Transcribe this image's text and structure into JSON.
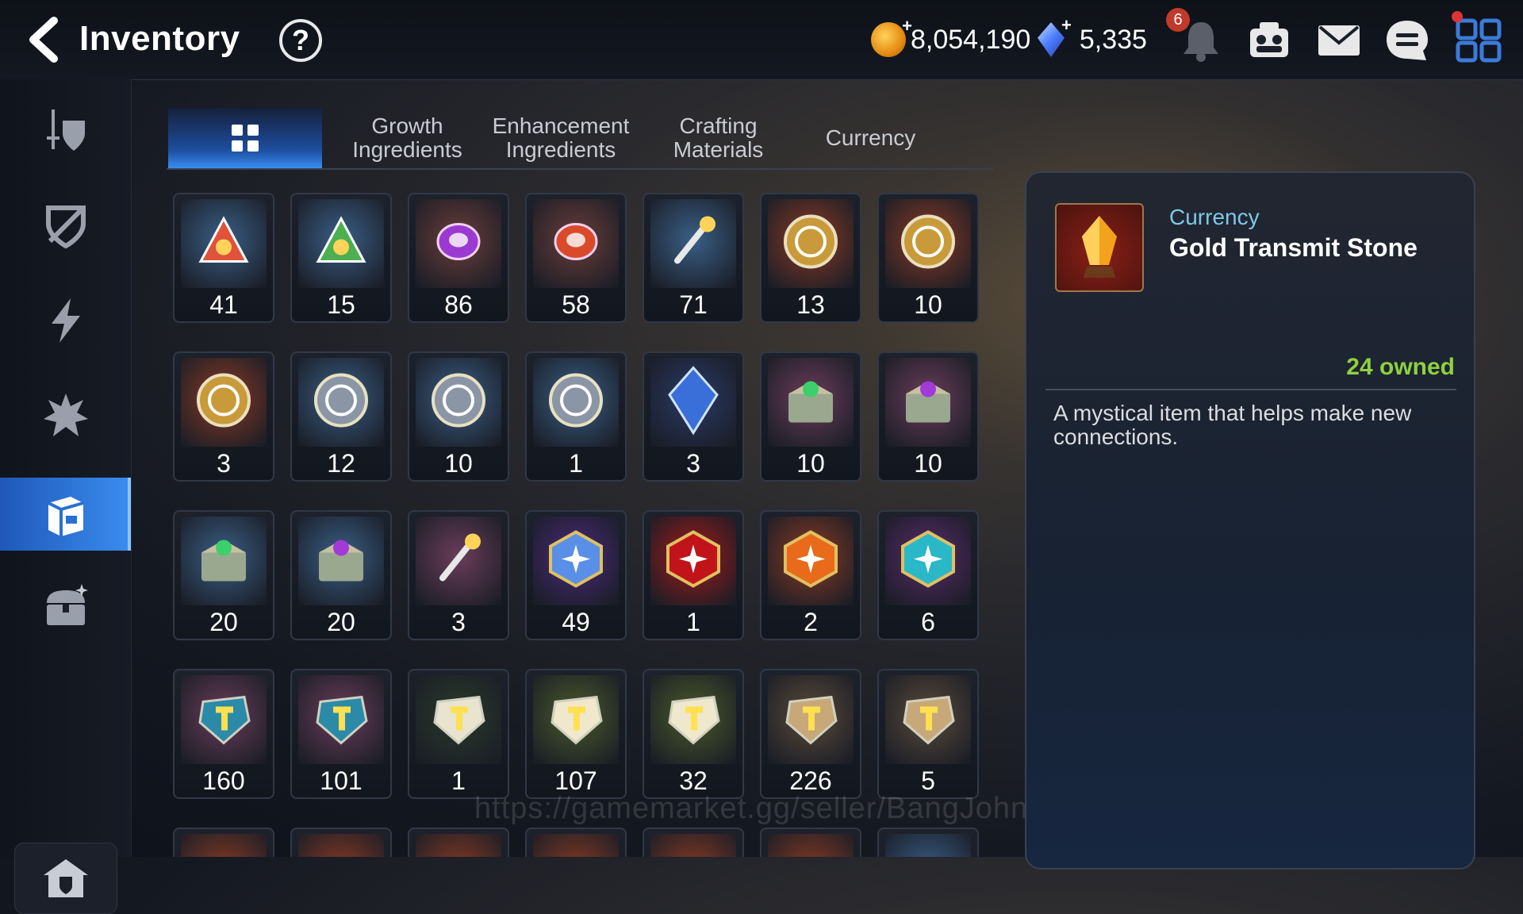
{
  "header": {
    "title": "Inventory",
    "help_label": "?",
    "gold": "8,054,190",
    "crystals": "5,335",
    "notification_count": "6"
  },
  "tabs": [
    {
      "label": "",
      "icon": "grid-icon",
      "active": true
    },
    {
      "label": "Growth\nIngredients"
    },
    {
      "label": "Enhancement\nIngredients"
    },
    {
      "label": "Crafting\nMaterials"
    },
    {
      "label": "Currency"
    }
  ],
  "sidebar": {
    "items": [
      "sword-shield-icon",
      "crossed-shield-icon",
      "lightning-icon",
      "spiked-icon",
      "bag-icon",
      "chest-icon"
    ],
    "active": "bag-icon",
    "bottom": "house-icon"
  },
  "items": [
    {
      "qty": "41",
      "color": "#3a5f86",
      "icon": "red-triangle-rune"
    },
    {
      "qty": "15",
      "color": "#3a5f86",
      "icon": "green-triangle-rune"
    },
    {
      "qty": "86",
      "color": "#6a3d3a",
      "icon": "purple-orb-rune"
    },
    {
      "qty": "58",
      "color": "#6a3d3a",
      "icon": "red-orb-rune"
    },
    {
      "qty": "71",
      "color": "#3a5f86",
      "icon": "golden-feather"
    },
    {
      "qty": "13",
      "color": "#8a3a24",
      "icon": "gold-feather-coin"
    },
    {
      "qty": "10",
      "color": "#8a3a24",
      "icon": "gold-shield-coin"
    },
    {
      "qty": "3",
      "color": "#8a3a24",
      "icon": "gold-bow-coin"
    },
    {
      "qty": "12",
      "color": "#3a5f86",
      "icon": "silver-feather-coin"
    },
    {
      "qty": "10",
      "color": "#3a5f86",
      "icon": "silver-shield-coin"
    },
    {
      "qty": "1",
      "color": "#3a5f86",
      "icon": "silver-spiral-coin"
    },
    {
      "qty": "3",
      "color": "#2a3a66",
      "icon": "blue-crystal"
    },
    {
      "qty": "10",
      "color": "#6a3d5a",
      "icon": "green-gem-chest"
    },
    {
      "qty": "10",
      "color": "#6a3d5a",
      "icon": "purple-gem-chest"
    },
    {
      "qty": "20",
      "color": "#3a5f86",
      "icon": "green-gem-chest"
    },
    {
      "qty": "20",
      "color": "#3a5f86",
      "icon": "purple-gem-chest"
    },
    {
      "qty": "3",
      "color": "#6a3d5a",
      "icon": "feather-staff"
    },
    {
      "qty": "49",
      "color": "#4a2a7a",
      "icon": "blue-swirl-stone"
    },
    {
      "qty": "1",
      "color": "#a01a1a",
      "icon": "red-star-gem"
    },
    {
      "qty": "2",
      "color": "#8a3a24",
      "icon": "orange-hammer-gem"
    },
    {
      "qty": "6",
      "color": "#5a2a6a",
      "icon": "cyan-star-gem"
    },
    {
      "qty": "160",
      "color": "#6a3d5a",
      "icon": "yellow-t-stone"
    },
    {
      "qty": "101",
      "color": "#6a3d5a",
      "icon": "yellow-bolt-stone"
    },
    {
      "qty": "1",
      "color": "#2a3a2a",
      "icon": "star-stone"
    },
    {
      "qty": "107",
      "color": "#4a5a2a",
      "icon": "orange-t-stone"
    },
    {
      "qty": "32",
      "color": "#4a5a2a",
      "icon": "orange-bolt-stone"
    },
    {
      "qty": "226",
      "color": "#5a4a3a",
      "icon": "teal-t-stone"
    },
    {
      "qty": "5",
      "color": "#5a4a3a",
      "icon": "teal-bolt-stone"
    },
    {
      "qty": "",
      "color": "#8a3a24",
      "icon": "partial"
    },
    {
      "qty": "",
      "color": "#8a3a24",
      "icon": "partial"
    },
    {
      "qty": "",
      "color": "#8a3a24",
      "icon": "partial"
    },
    {
      "qty": "",
      "color": "#8a3a24",
      "icon": "partial"
    },
    {
      "qty": "",
      "color": "#8a3a24",
      "icon": "partial"
    },
    {
      "qty": "",
      "color": "#8a3a24",
      "icon": "partial"
    },
    {
      "qty": "",
      "color": "#3a5f86",
      "icon": "partial"
    }
  ],
  "detail": {
    "category": "Currency",
    "name": "Gold Transmit Stone",
    "owned": "24 owned",
    "description": "A mystical item that helps make new connections."
  },
  "watermark": "https://gamemarket.gg/seller/BangJohn"
}
